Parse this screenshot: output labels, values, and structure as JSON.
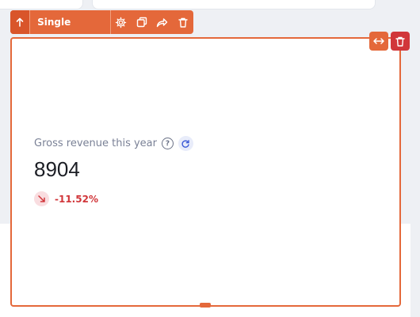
{
  "toolbar": {
    "title": "Single Value",
    "accent_color": "#e4683a",
    "icons": [
      "arrow-up-icon",
      "gear-icon",
      "duplicate-icon",
      "share-icon",
      "trash-icon"
    ]
  },
  "widget": {
    "label": "Gross revenue this year",
    "help_icon_glyph": "?",
    "value": "8904",
    "change": "-11.52%",
    "trend": "down",
    "change_color": "#d1363a",
    "corner_actions": [
      "resize-width-icon",
      "trash-icon"
    ]
  }
}
